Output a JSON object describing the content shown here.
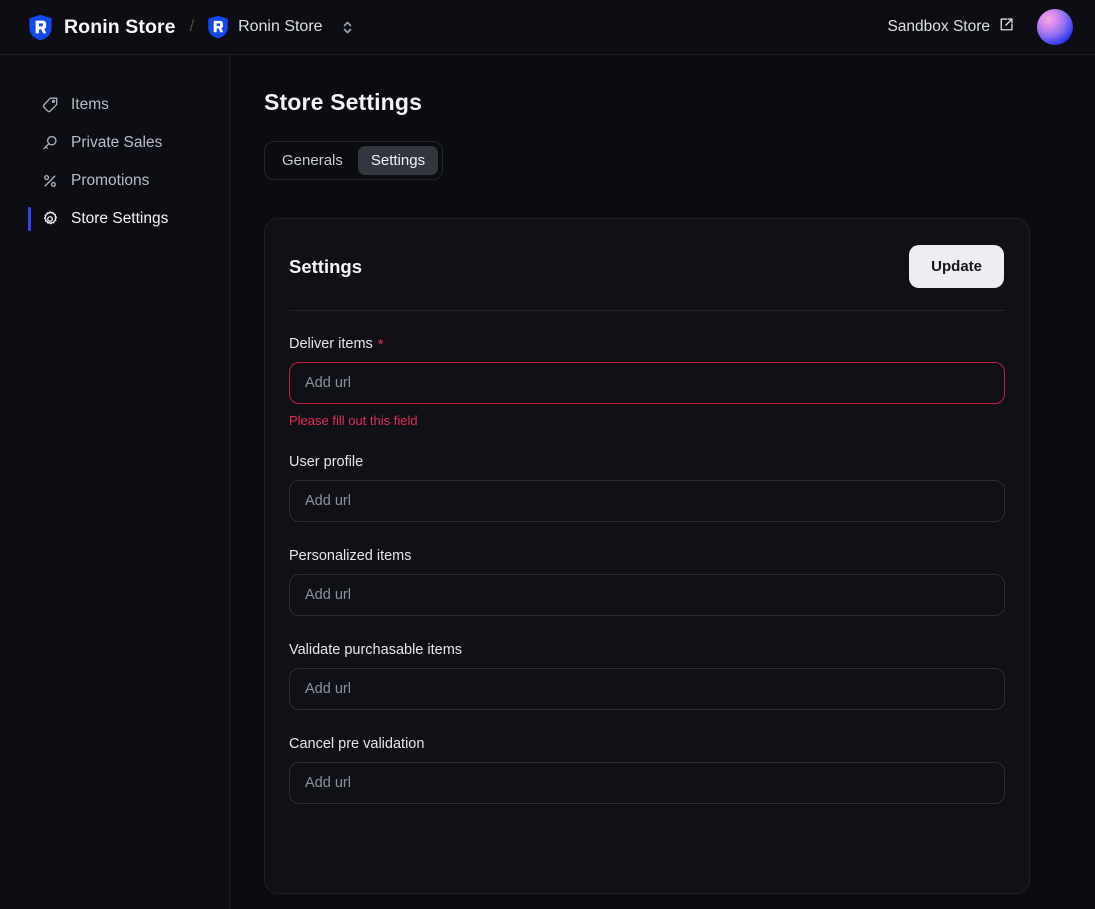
{
  "header": {
    "brand_name": "Ronin Store",
    "brand_icon": "ronin-shield-icon",
    "breadcrumb_separator": "/",
    "crumb_store_label": "Ronin Store",
    "crumb_store_icon": "ronin-shield-icon",
    "selector_icon": "chevron-up-down-icon",
    "sandbox_label": "Sandbox Store",
    "external_link_icon": "external-link-icon",
    "avatar_icon": "user-avatar"
  },
  "sidebar": {
    "items": [
      {
        "label": "Items",
        "icon": "tag-icon",
        "active": false
      },
      {
        "label": "Private Sales",
        "icon": "key-icon",
        "active": false
      },
      {
        "label": "Promotions",
        "icon": "percent-icon",
        "active": false
      },
      {
        "label": "Store Settings",
        "icon": "gear-icon",
        "active": true
      }
    ]
  },
  "main": {
    "page_title": "Store Settings",
    "tabs": [
      {
        "label": "Generals",
        "active": false
      },
      {
        "label": "Settings",
        "active": true
      }
    ],
    "card": {
      "title": "Settings",
      "update_label": "Update",
      "fields": [
        {
          "label": "Deliver items",
          "required": true,
          "required_marker": "*",
          "value": "",
          "placeholder": "Add url",
          "error": "Please fill out this field"
        },
        {
          "label": "User profile",
          "required": false,
          "value": "",
          "placeholder": "Add url",
          "error": ""
        },
        {
          "label": "Personalized items",
          "required": false,
          "value": "",
          "placeholder": "Add url",
          "error": ""
        },
        {
          "label": "Validate purchasable items",
          "required": false,
          "value": "",
          "placeholder": "Add url",
          "error": ""
        },
        {
          "label": "Cancel pre validation",
          "required": false,
          "value": "",
          "placeholder": "Add url",
          "error": ""
        }
      ]
    }
  },
  "colors": {
    "page_bg": "#0b0c10",
    "panel_bg": "#0d0e13",
    "card_bg": "#101116",
    "accent_blue": "#2b4bf2",
    "error_red": "#e02d52",
    "button_light": "#eceef4"
  }
}
